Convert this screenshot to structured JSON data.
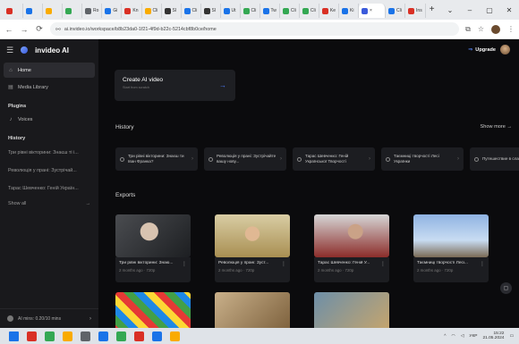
{
  "browser": {
    "tabs": [
      {
        "label": "",
        "color": "#d93025"
      },
      {
        "label": "",
        "color": "#1a73e8"
      },
      {
        "label": "",
        "color": "#f9ab00"
      },
      {
        "label": "",
        "color": "#34a853"
      },
      {
        "label": "Ro",
        "color": "#5f6368"
      },
      {
        "label": "Gi",
        "color": "#1a73e8"
      },
      {
        "label": "Kn",
        "color": "#d93025"
      },
      {
        "label": "Cli",
        "color": "#f9ab00"
      },
      {
        "label": "Sl",
        "color": "#333333"
      },
      {
        "label": "Cli",
        "color": "#1a73e8"
      },
      {
        "label": "Sl",
        "color": "#333333"
      },
      {
        "label": "Ut",
        "color": "#1a73e8"
      },
      {
        "label": "Cli",
        "color": "#34a853"
      },
      {
        "label": "Tw",
        "color": "#1a73e8"
      },
      {
        "label": "Cli",
        "color": "#34a853"
      },
      {
        "label": "Cli",
        "color": "#34a853"
      },
      {
        "label": "Ke",
        "color": "#d93025"
      },
      {
        "label": "Ki",
        "color": "#1a73e8"
      },
      {
        "label": "×",
        "color": "#3b5bdb",
        "active": true
      },
      {
        "label": "Cli",
        "color": "#1a73e8"
      },
      {
        "label": "Ins",
        "color": "#d93025"
      }
    ],
    "new_tab": "+",
    "url": "ai.invideo.io/workspace/b8b23da0-1f21-4f9d-b22c-5214cbf8b0ce/home",
    "window_controls": [
      "⌄",
      "–",
      "▢",
      "✕"
    ]
  },
  "sidebar": {
    "brand": "invideo AI",
    "nav": [
      {
        "label": "Home",
        "icon": "home-icon",
        "active": true
      },
      {
        "label": "Media Library",
        "icon": "media-icon",
        "active": false
      }
    ],
    "plugins_heading": "Plugins",
    "plugins": [
      {
        "label": "Voices",
        "icon": "mic-icon"
      }
    ],
    "history_heading": "History",
    "history": [
      "Три рівні вікторини: Знаєш ті і...",
      "Революція у прані: Зустрічай...",
      "Тарас Шевченко: Геній Україн..."
    ],
    "show_all": "Show all",
    "footer": "AI mins: 0.20/10 mins"
  },
  "main": {
    "upgrade": "Upgrade",
    "create_title": "Create AI video",
    "create_sub": "Start from scratch",
    "history_title": "History",
    "show_more": "Show more →",
    "history_cards": [
      "Три рівні вікторини: Знаєш ти Іван Франка?",
      "Революція у прані: Зустрічайте вашу нову...",
      "Тарас Шевченко: Геній Української Творчості",
      "Таємниці творчості Лесі Українки",
      "Путешествие в славянские ар"
    ],
    "exports_title": "Exports",
    "exports": [
      {
        "title": "Три рівні вікторини: Знаю...",
        "meta": "2 months ago · 720p"
      },
      {
        "title": "Революція у прані: Зуст...",
        "meta": "2 months ago · 720p"
      },
      {
        "title": "Тарас Шевченко: Геній У...",
        "meta": "2 months ago · 720p"
      },
      {
        "title": "Таємниці творчості Лесі...",
        "meta": "2 months ago · 720p"
      },
      {
        "title": "",
        "meta": ""
      },
      {
        "title": "",
        "meta": ""
      },
      {
        "title": "",
        "meta": ""
      }
    ]
  },
  "taskbar": {
    "icons": [
      {
        "name": "windows-icon",
        "color": "#1a73e8"
      },
      {
        "name": "opera-icon",
        "color": "#d93025"
      },
      {
        "name": "whatsapp-icon",
        "color": "#34a853"
      },
      {
        "name": "files-icon",
        "color": "#f9ab00"
      },
      {
        "name": "app-icon",
        "color": "#5f6368"
      },
      {
        "name": "telegram-icon",
        "color": "#1a73e8"
      },
      {
        "name": "chrome-icon",
        "color": "#34a853"
      },
      {
        "name": "app2-icon",
        "color": "#d93025"
      },
      {
        "name": "app3-icon",
        "color": "#1a73e8"
      },
      {
        "name": "chrome2-icon",
        "color": "#f9ab00"
      }
    ],
    "lang": "УКР",
    "time": "15:22",
    "date": "21.05.2024"
  }
}
